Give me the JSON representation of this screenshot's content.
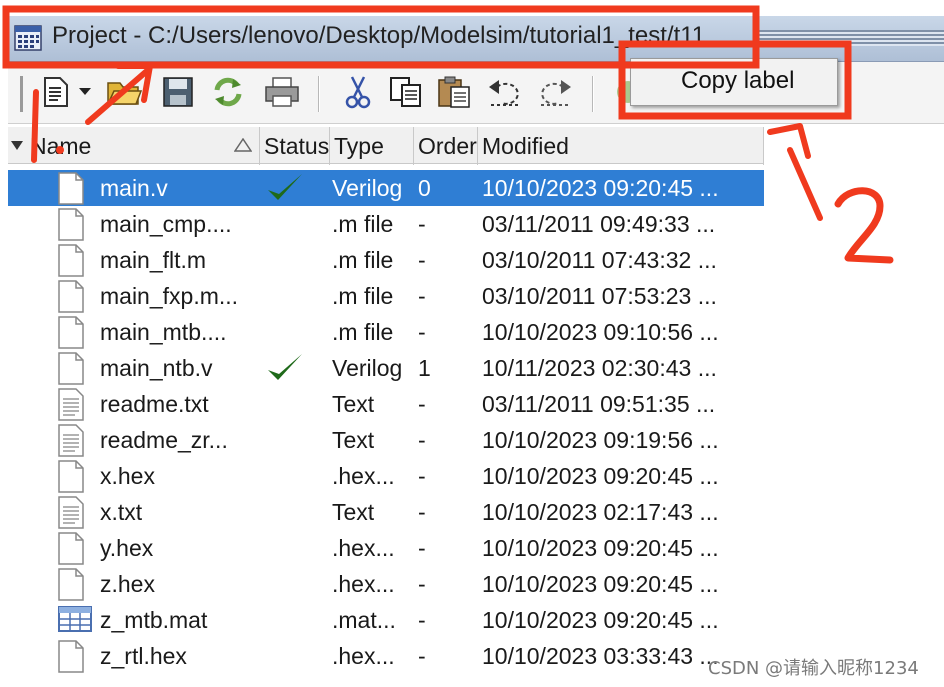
{
  "window": {
    "title": "Project - C:/Users/lenovo/Desktop/Modelsim/tutorial1_test/t11",
    "icon": "project-window-icon"
  },
  "toolbar": {
    "icons": [
      "new-file-icon",
      "dropdown-arrow-icon",
      "open-folder-icon",
      "save-icon",
      "reload-icon",
      "print-icon",
      "cut-icon",
      "copy-icon",
      "paste-icon",
      "undo-icon",
      "redo-icon",
      "compile-icon"
    ]
  },
  "context_menu": {
    "items": [
      {
        "label": "Copy label"
      }
    ]
  },
  "columns": {
    "name": "Name",
    "status": "Status",
    "type": "Type",
    "order": "Order",
    "modified": "Modified"
  },
  "files": [
    {
      "name": "main.v",
      "status": "ok",
      "type": "Verilog",
      "order": "0",
      "modified": "10/10/2023 09:20:45 ...",
      "icon": "file-icon",
      "selected": true
    },
    {
      "name": "main_cmp....",
      "status": "",
      "type": ".m file",
      "order": "-",
      "modified": "03/11/2011 09:49:33 ...",
      "icon": "file-icon"
    },
    {
      "name": "main_flt.m",
      "status": "",
      "type": ".m file",
      "order": "-",
      "modified": "03/10/2011 07:43:32 ...",
      "icon": "file-icon"
    },
    {
      "name": "main_fxp.m...",
      "status": "",
      "type": ".m file",
      "order": "-",
      "modified": "03/10/2011 07:53:23 ...",
      "icon": "file-icon"
    },
    {
      "name": "main_mtb....",
      "status": "",
      "type": ".m file",
      "order": "-",
      "modified": "10/10/2023 09:10:56 ...",
      "icon": "file-icon"
    },
    {
      "name": "main_ntb.v",
      "status": "ok",
      "type": "Verilog",
      "order": "1",
      "modified": "10/11/2023 02:30:43 ...",
      "icon": "file-icon"
    },
    {
      "name": "readme.txt",
      "status": "",
      "type": "Text",
      "order": "-",
      "modified": "03/11/2011 09:51:35 ...",
      "icon": "text-file-icon"
    },
    {
      "name": "readme_zr...",
      "status": "",
      "type": "Text",
      "order": "-",
      "modified": "10/10/2023 09:19:56 ...",
      "icon": "text-file-icon"
    },
    {
      "name": "x.hex",
      "status": "",
      "type": ".hex...",
      "order": "-",
      "modified": "10/10/2023 09:20:45 ...",
      "icon": "file-icon"
    },
    {
      "name": "x.txt",
      "status": "",
      "type": "Text",
      "order": "-",
      "modified": "10/10/2023 02:17:43 ...",
      "icon": "text-file-icon"
    },
    {
      "name": "y.hex",
      "status": "",
      "type": ".hex...",
      "order": "-",
      "modified": "10/10/2023 09:20:45 ...",
      "icon": "file-icon"
    },
    {
      "name": "z.hex",
      "status": "",
      "type": ".hex...",
      "order": "-",
      "modified": "10/10/2023 09:20:45 ...",
      "icon": "file-icon"
    },
    {
      "name": "z_mtb.mat",
      "status": "",
      "type": ".mat...",
      "order": "-",
      "modified": "10/10/2023 09:20:45 ...",
      "icon": "mat-file-icon"
    },
    {
      "name": "z_rtl.hex",
      "status": "",
      "type": ".hex...",
      "order": "-",
      "modified": "10/10/2023 03:33:43 ...",
      "icon": "file-icon"
    }
  ],
  "annotations": {
    "color": "#f03a1e",
    "label_1": "1.",
    "label_2": "2"
  },
  "watermark": "CSDN @请输入昵称1234",
  "colors": {
    "selection": "#2f7ed4",
    "check": "#1f6a1a"
  }
}
